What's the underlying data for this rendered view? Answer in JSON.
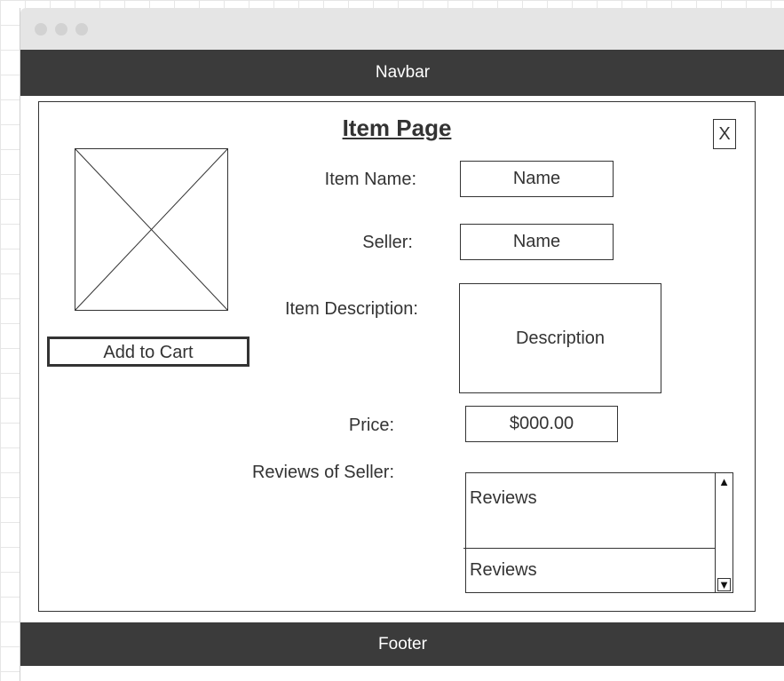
{
  "window": {
    "controls": [
      "close-dot",
      "minimize-dot",
      "maximize-dot"
    ]
  },
  "navbar": {
    "label": "Navbar"
  },
  "footer": {
    "label": "Footer"
  },
  "page": {
    "title": "Item Page",
    "close_label": "X"
  },
  "item": {
    "add_to_cart_label": "Add to Cart",
    "name_label": "Item Name:",
    "name_value": "Name",
    "seller_label": "Seller:",
    "seller_value": "Name",
    "description_label": "Item Description:",
    "description_value": "Description",
    "price_label": "Price:",
    "price_value": "$000.00",
    "reviews_label": "Reviews of Seller:",
    "reviews": [
      "Reviews",
      "Reviews"
    ],
    "scroll_up": "▲",
    "scroll_down": "▼"
  },
  "colors": {
    "bar": "#3b3b3b",
    "text": "#333333",
    "titlebar": "#e5e5e5"
  },
  "icons": {
    "image_placeholder": "image-placeholder-icon",
    "scroll_up": "triangle-up-icon",
    "scroll_down": "triangle-down-icon"
  }
}
